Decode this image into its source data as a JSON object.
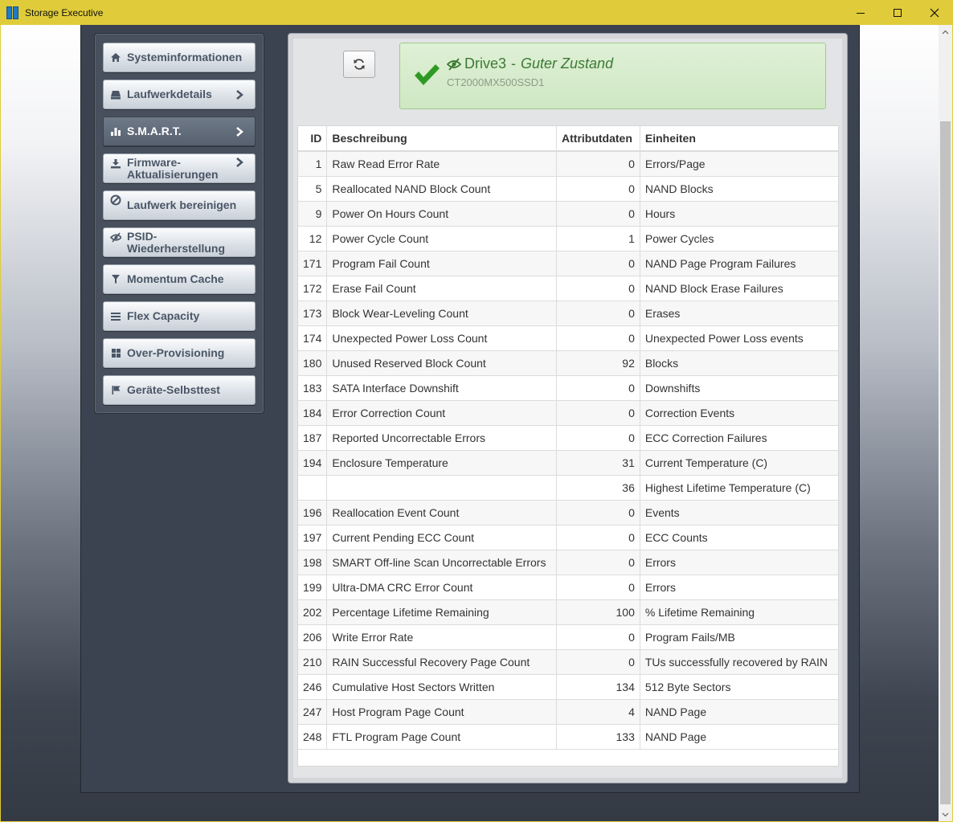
{
  "window": {
    "title": "Storage Executive",
    "controls": [
      "minimize",
      "maximize",
      "close"
    ]
  },
  "sidebar": {
    "items": [
      {
        "label": "Systeminformationen",
        "icon": "home-icon",
        "chevron": false,
        "active": false
      },
      {
        "label": "Laufwerkdetails",
        "icon": "drive-icon",
        "chevron": true,
        "active": false
      },
      {
        "label": "S.M.A.R.T.",
        "icon": "bar-chart-icon",
        "chevron": true,
        "active": true
      },
      {
        "label": "Firmware-Aktualisierungen",
        "icon": "download-icon",
        "chevron": true,
        "active": false
      },
      {
        "label": "Laufwerk bereinigen",
        "icon": "ban-icon",
        "chevron": false,
        "active": false
      },
      {
        "label": "PSID-Wiederherstellung",
        "icon": "eye-slash-icon",
        "chevron": false,
        "active": false
      },
      {
        "label": "Momentum Cache",
        "icon": "filter-icon",
        "chevron": false,
        "active": false
      },
      {
        "label": "Flex Capacity",
        "icon": "list-icon",
        "chevron": false,
        "active": false
      },
      {
        "label": "Over-Provisioning",
        "icon": "grid-icon",
        "chevron": false,
        "active": false
      },
      {
        "label": "Geräte-Selbsttest",
        "icon": "flag-icon",
        "chevron": false,
        "active": false
      }
    ]
  },
  "status": {
    "drive": "Drive3",
    "separator": "-",
    "health": "Guter Zustand",
    "model": "CT2000MX500SSD1",
    "color": "#3c7a34"
  },
  "table": {
    "headers": {
      "id": "ID",
      "desc": "Beschreibung",
      "value": "Attributdaten",
      "unit": "Einheiten"
    },
    "rows": [
      {
        "id": "1",
        "desc": "Raw Read Error Rate",
        "value": "0",
        "unit": "Errors/Page"
      },
      {
        "id": "5",
        "desc": "Reallocated NAND Block Count",
        "value": "0",
        "unit": "NAND Blocks"
      },
      {
        "id": "9",
        "desc": "Power On Hours Count",
        "value": "0",
        "unit": "Hours"
      },
      {
        "id": "12",
        "desc": "Power Cycle Count",
        "value": "1",
        "unit": "Power Cycles"
      },
      {
        "id": "171",
        "desc": "Program Fail Count",
        "value": "0",
        "unit": "NAND Page Program Failures"
      },
      {
        "id": "172",
        "desc": "Erase Fail Count",
        "value": "0",
        "unit": "NAND Block Erase Failures"
      },
      {
        "id": "173",
        "desc": "Block Wear-Leveling Count",
        "value": "0",
        "unit": "Erases"
      },
      {
        "id": "174",
        "desc": "Unexpected Power Loss Count",
        "value": "0",
        "unit": "Unexpected Power Loss events"
      },
      {
        "id": "180",
        "desc": "Unused Reserved Block Count",
        "value": "92",
        "unit": "Blocks"
      },
      {
        "id": "183",
        "desc": "SATA Interface Downshift",
        "value": "0",
        "unit": "Downshifts"
      },
      {
        "id": "184",
        "desc": "Error Correction Count",
        "value": "0",
        "unit": "Correction Events"
      },
      {
        "id": "187",
        "desc": "Reported Uncorrectable Errors",
        "value": "0",
        "unit": "ECC Correction Failures"
      },
      {
        "id": "194",
        "desc": "Enclosure Temperature",
        "value": "31",
        "unit": "Current Temperature (C)"
      },
      {
        "id": "",
        "desc": "",
        "value": "36",
        "unit": "Highest Lifetime Temperature (C)"
      },
      {
        "id": "196",
        "desc": "Reallocation Event Count",
        "value": "0",
        "unit": "Events"
      },
      {
        "id": "197",
        "desc": "Current Pending ECC Count",
        "value": "0",
        "unit": "ECC Counts"
      },
      {
        "id": "198",
        "desc": "SMART Off-line Scan Uncorrectable Errors",
        "value": "0",
        "unit": "Errors"
      },
      {
        "id": "199",
        "desc": "Ultra-DMA CRC Error Count",
        "value": "0",
        "unit": "Errors"
      },
      {
        "id": "202",
        "desc": "Percentage Lifetime Remaining",
        "value": "100",
        "unit": "% Lifetime Remaining"
      },
      {
        "id": "206",
        "desc": "Write Error Rate",
        "value": "0",
        "unit": "Program Fails/MB"
      },
      {
        "id": "210",
        "desc": "RAIN Successful Recovery Page Count",
        "value": "0",
        "unit": "TUs successfully recovered by RAIN"
      },
      {
        "id": "246",
        "desc": "Cumulative Host Sectors Written",
        "value": "134",
        "unit": "512 Byte Sectors"
      },
      {
        "id": "247",
        "desc": "Host Program Page Count",
        "value": "4",
        "unit": "NAND Page"
      },
      {
        "id": "248",
        "desc": "FTL Program Page Count",
        "value": "133",
        "unit": "NAND Page"
      }
    ]
  }
}
